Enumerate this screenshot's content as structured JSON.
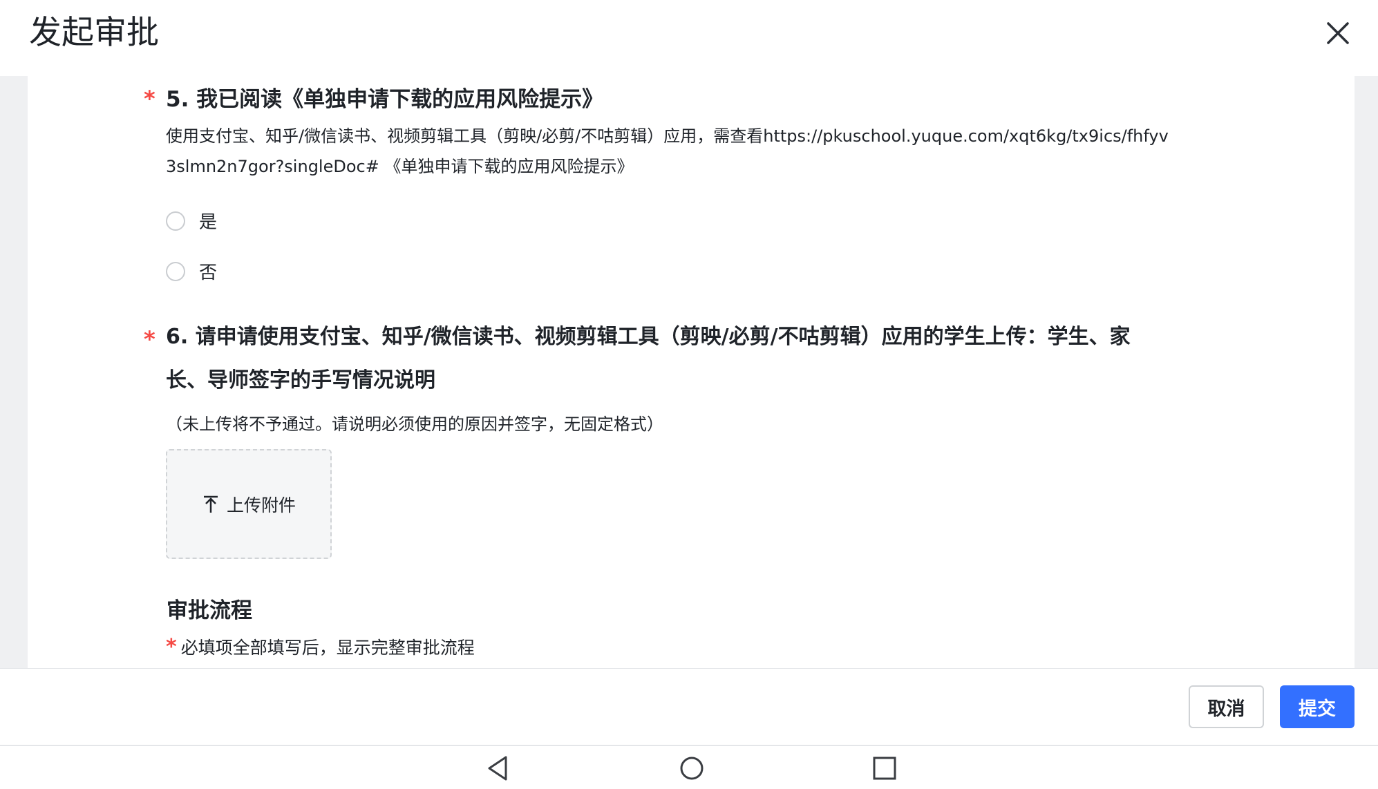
{
  "header": {
    "title": "发起审批",
    "close_icon": "close-icon"
  },
  "question5": {
    "required_mark": "*",
    "title": "5. 我已阅读《单独申请下载的应用风险提示》",
    "desc_line1": "使用支付宝、知乎/微信读书、视频剪辑工具（剪映/必剪/不咕剪辑）应用，需查看https://pkuschool.yuque.com/xqt6kg/tx9ics/fhfyv",
    "desc_line2": "3slmn2n7gor?singleDoc# 《单独申请下载的应用风险提示》",
    "options": [
      {
        "label": "是"
      },
      {
        "label": "否"
      }
    ]
  },
  "question6": {
    "required_mark": "*",
    "title_line1": "6. 请申请使用支付宝、知乎/微信读书、视频剪辑工具（剪映/必剪/不咕剪辑）应用的学生上传：学生、家",
    "title_line2": "长、导师签字的手写情况说明",
    "hint": "（未上传将不予通过。请说明必须使用的原因并签字，无固定格式）",
    "upload_label": "上传附件",
    "upload_icon": "upload-arrow-icon"
  },
  "flow": {
    "title": "审批流程",
    "note_mark": "*",
    "note": "必填项全部填写后，显示完整审批流程"
  },
  "footer": {
    "cancel_label": "取消",
    "submit_label": "提交"
  },
  "colors": {
    "accent": "#3370ff",
    "required": "#f54a45",
    "panel_bg": "#eff0f2"
  },
  "navbar": {
    "icons": [
      "back-triangle-icon",
      "home-circle-icon",
      "recents-square-icon"
    ]
  }
}
